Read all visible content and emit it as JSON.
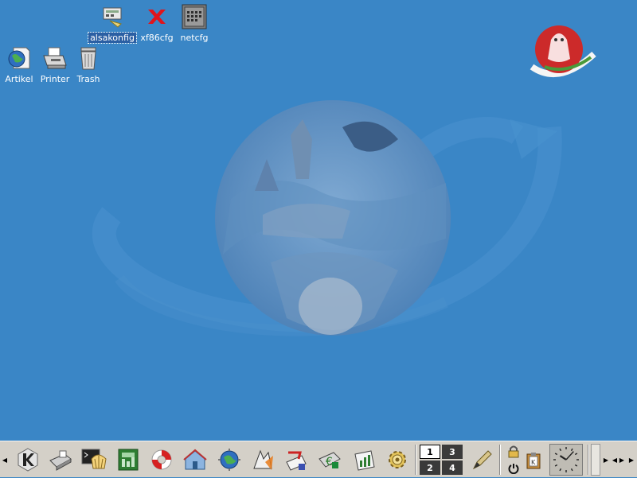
{
  "desktop": {
    "icons": [
      {
        "label": "alsakonfig",
        "icon": "alsakonfig-icon",
        "selected": true
      },
      {
        "label": "xf86cfg",
        "icon": "xf86cfg-x-icon"
      },
      {
        "label": "netcfg",
        "icon": "netcfg-icon"
      },
      {
        "label": "Artikel",
        "icon": "globe-document-icon"
      },
      {
        "label": "Printer",
        "icon": "printer-icon"
      },
      {
        "label": "Trash",
        "icon": "trash-icon"
      }
    ],
    "colors": {
      "background": "#3a86c6",
      "selection": "#2b5fa3"
    }
  },
  "panel": {
    "launchers": [
      "k-menu-icon",
      "printer-settings-icon",
      "terminal-shell-icon",
      "spreadsheet-icon",
      "help-lifebuoy-icon",
      "home-folder-icon",
      "web-browser-icon",
      "globe-search-icon",
      "vector-draw-icon",
      "mail-icon",
      "office-suite-icon",
      "chart-presentation-icon",
      "control-center-gear-icon"
    ],
    "pager": {
      "desktops": [
        "1",
        "3",
        "2",
        "4"
      ],
      "active": "1"
    },
    "applets": [
      "writing-pen-icon",
      "lock-screen-icon",
      "logout-power-icon",
      "klipper-clipboard-icon"
    ],
    "clock": {
      "hour": 10,
      "minute": 7
    }
  }
}
